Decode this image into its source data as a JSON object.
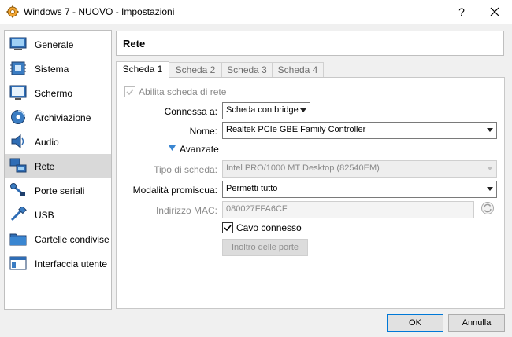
{
  "window": {
    "title": "Windows 7 - NUOVO - Impostazioni",
    "help_label": "?"
  },
  "sidebar": {
    "items": [
      {
        "label": "Generale"
      },
      {
        "label": "Sistema"
      },
      {
        "label": "Schermo"
      },
      {
        "label": "Archiviazione"
      },
      {
        "label": "Audio"
      },
      {
        "label": "Rete"
      },
      {
        "label": "Porte seriali"
      },
      {
        "label": "USB"
      },
      {
        "label": "Cartelle condivise"
      },
      {
        "label": "Interfaccia utente"
      }
    ],
    "selected": "Rete"
  },
  "panel": {
    "title": "Rete"
  },
  "tabs": [
    "Scheda 1",
    "Scheda 2",
    "Scheda 3",
    "Scheda 4"
  ],
  "form": {
    "enable_label": "Abilita scheda di rete",
    "attached_label": "Connessa a:",
    "attached_value": "Scheda con bridge",
    "name_label": "Nome:",
    "name_value": "Realtek PCIe GBE Family Controller",
    "advanced_label": "Avanzate",
    "adapter_type_label": "Tipo di scheda:",
    "adapter_type_value": "Intel PRO/1000 MT Desktop (82540EM)",
    "promisc_label": "Modalità promiscua:",
    "promisc_value": "Permetti tutto",
    "mac_label": "Indirizzo MAC:",
    "mac_value": "080027FFA6CF",
    "cable_label": "Cavo connesso",
    "port_forward_label": "Inoltro delle porte"
  },
  "buttons": {
    "ok": "OK",
    "cancel": "Annulla"
  }
}
